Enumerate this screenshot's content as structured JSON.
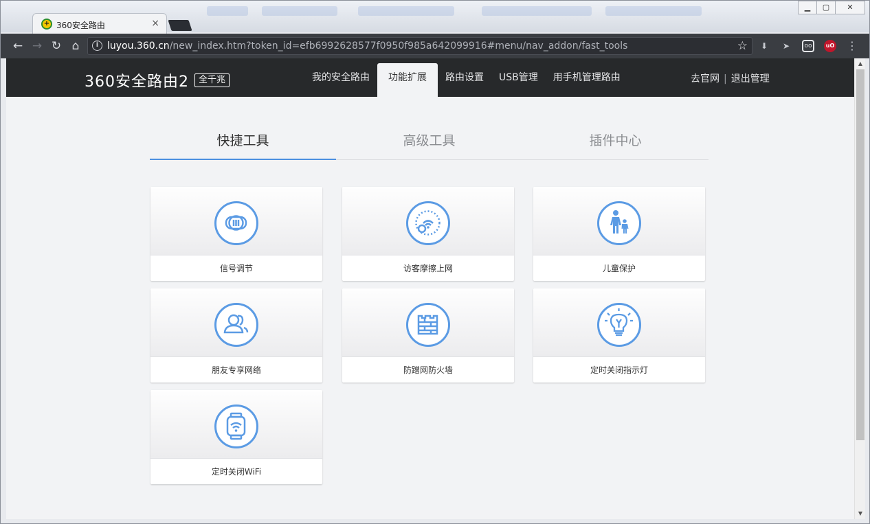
{
  "browser": {
    "tab_title": "360安全路由",
    "tab_close": "×",
    "url_host": "luyou.360.cn",
    "url_path": "/new_index.htm?token_id=efb6992628577f0950f985a642099916#menu/nav_addon/fast_tools",
    "window_buttons": [
      "▁",
      "▢",
      "✕"
    ]
  },
  "header": {
    "brand_name": "360安全路由2",
    "brand_badge": "全千兆",
    "nav": [
      {
        "label": "我的安全路由"
      },
      {
        "label": "功能扩展",
        "active": true
      },
      {
        "label": "路由设置"
      },
      {
        "label": "USB管理"
      },
      {
        "label": "用手机管理路由"
      }
    ],
    "links": {
      "website": "去官网",
      "divider": "|",
      "logout": "退出管理"
    }
  },
  "subtabs": [
    {
      "label": "快捷工具",
      "active": true
    },
    {
      "label": "高级工具"
    },
    {
      "label": "插件中心"
    }
  ],
  "tools": [
    {
      "label": "信号调节",
      "icon": "signal-adjust-icon"
    },
    {
      "label": "访客摩擦上网",
      "icon": "guest-wifi-icon"
    },
    {
      "label": "儿童保护",
      "icon": "child-protection-icon"
    },
    {
      "label": "朋友专享网络",
      "icon": "friends-network-icon"
    },
    {
      "label": "防蹭网防火墙",
      "icon": "firewall-icon"
    },
    {
      "label": "定时关闭指示灯",
      "icon": "light-timer-icon"
    },
    {
      "label": "定时关闭WiFi",
      "icon": "wifi-timer-icon"
    }
  ],
  "colors": {
    "accent": "#4c8fe0",
    "icon_blue": "#5b9be4",
    "header_bg": "#27292b"
  }
}
